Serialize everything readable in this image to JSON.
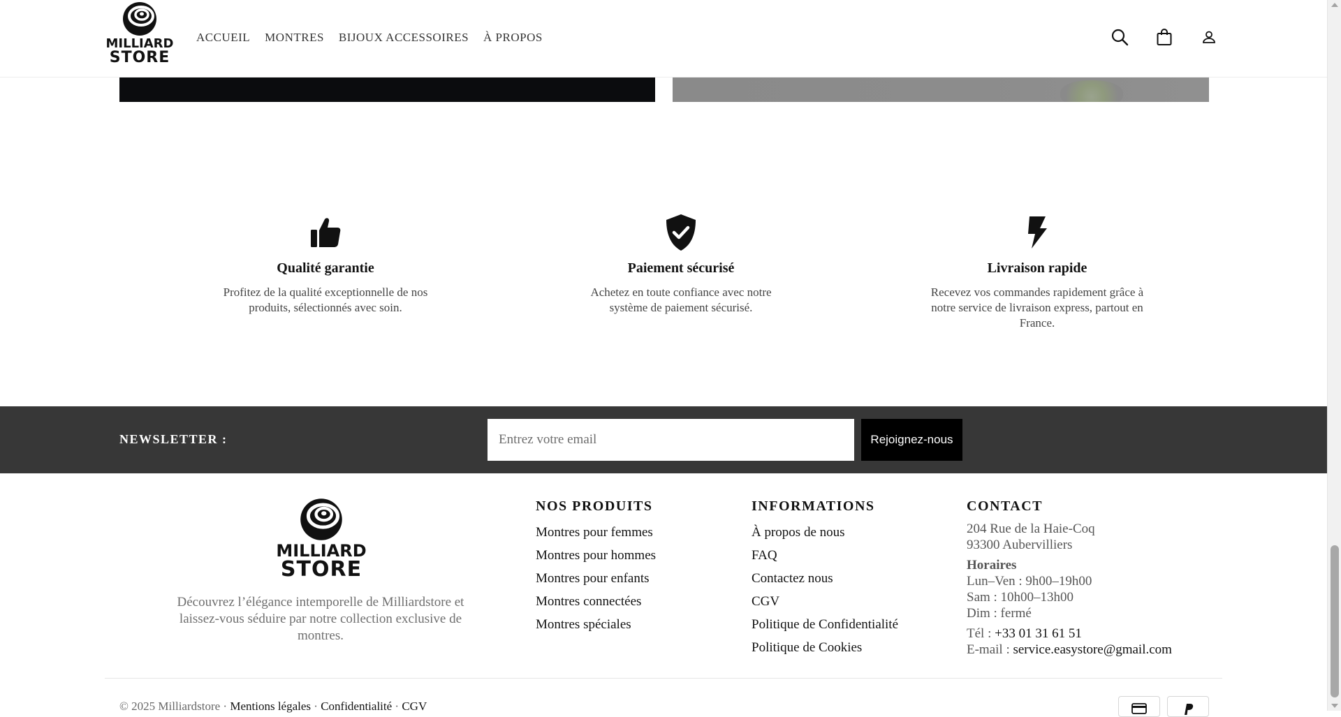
{
  "header": {
    "logo": {
      "line1": "MILLIARD",
      "line2": "STORE",
      "icon": "striped-sphere-logo"
    },
    "nav": [
      {
        "label": "ACCUEIL"
      },
      {
        "label": "MONTRES"
      },
      {
        "label": "BIJOUX ACCESSOIRES"
      },
      {
        "label": "À PROPOS"
      }
    ],
    "icons": [
      "search-icon",
      "shopping-bag-icon",
      "user-icon"
    ]
  },
  "features": [
    {
      "icon": "thumbs-up-icon",
      "title": "Qualité garantie",
      "text": "Profitez de la qualité exceptionnelle de nos produits, sélectionnés avec soin."
    },
    {
      "icon": "shield-check-icon",
      "title": "Paiement sécurisé",
      "text": "Achetez en toute confiance avec notre système de paiement sécurisé."
    },
    {
      "icon": "lightning-bolt-icon",
      "title": "Livraison rapide",
      "text": "Recevez vos commandes rapidement grâce à notre service de livraison express, partout en France."
    }
  ],
  "newsletter": {
    "title": "NEWSLETTER :",
    "placeholder": "Entrez votre email",
    "button": "Rejoignez-nous"
  },
  "footer": {
    "logo": {
      "line1": "MILLIARD",
      "line2": "STORE"
    },
    "description": "Découvrez l’élégance intemporelle de Milliardstore et laissez-vous séduire par notre collection exclusive de montres.",
    "products": {
      "title": "NOS PRODUITS",
      "links": [
        "Montres pour femmes",
        "Montres pour hommes",
        "Montres pour enfants",
        "Montres connectées",
        "Montres spéciales"
      ]
    },
    "informations": {
      "title": "INFORMATIONS",
      "links": [
        "À propos de nous",
        "FAQ",
        "Contactez nous",
        "CGV",
        "Politique de Confidentialité",
        "Politique de Cookies"
      ]
    },
    "contact": {
      "title": "CONTACT",
      "address1": "204 Rue de la Haie-Coq",
      "address2": "93300 Aubervilliers",
      "hours_title": "Horaires",
      "hours": [
        "Lun–Ven : 9h00–19h00",
        "Sam : 10h00–13h00",
        "Dim : fermé"
      ],
      "tel_label": "Tél : ",
      "tel": "+33 01 31 61 51",
      "email_label": "E-mail : ",
      "email": "service.easystore@gmail.com"
    },
    "bottom": {
      "copyright": "© 2025 Milliardstore · ",
      "legal": "Mentions légales",
      "sep1": " · ",
      "privacy": "Confidentialité",
      "sep2": " · ",
      "cgv": "CGV"
    },
    "payment_icons": [
      "credit-card-icon",
      "paypal-icon"
    ]
  },
  "colors": {
    "newsletter_bg": "#373737",
    "accent": "#000000"
  }
}
